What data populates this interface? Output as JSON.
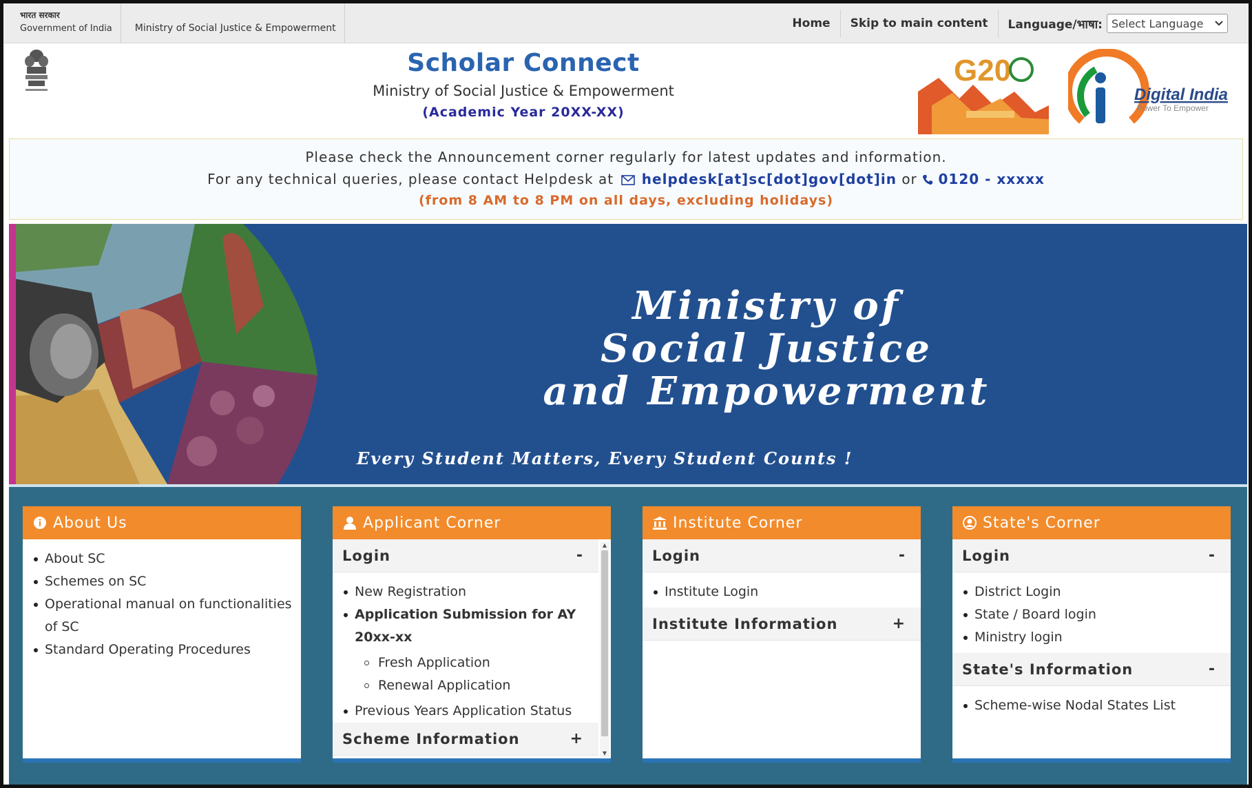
{
  "govbar": {
    "hindi_label": "भारत सरकार",
    "gov_label": "Government of India",
    "ministry_label": "Ministry of Social Justice & Empowerment",
    "links": [
      "Home",
      "Skip to main content"
    ],
    "language_label": "Language/भाषा:",
    "language_select": "Select Language"
  },
  "header": {
    "title": "Scholar Connect",
    "subtitle": "Ministry of Social Justice & Empowerment",
    "academic_year": "(Academic Year 20XX-XX)",
    "g20_text": "G20",
    "digital_india": "Digital India",
    "digital_india_tag": "Power To Empower"
  },
  "announcement": {
    "line1": "Please check the Announcement corner regularly for latest updates and information.",
    "line2_prefix": "For any technical queries, please contact Helpdesk at",
    "email": "helpdesk[at]sc[dot]gov[dot]in",
    "or": "or",
    "phone": "0120 - xxxxx",
    "line3": "(from 8 AM to 8 PM on all days, excluding holidays)"
  },
  "banner": {
    "title_line1": "Ministry of",
    "title_line2": "Social Justice",
    "title_line3": "and Empowerment",
    "tagline": "Every Student Matters, Every Student Counts !"
  },
  "cards": {
    "about": {
      "title": "About Us",
      "items": [
        "About SC",
        "Schemes on SC",
        "Operational manual on functionalities of SC",
        "Standard Operating Procedures"
      ]
    },
    "applicant": {
      "title": "Applicant Corner",
      "login_head": "Login",
      "login_toggle": "-",
      "new_registration": "New Registration",
      "application_submission": "Application Submission for AY 20xx-xx",
      "fresh": "Fresh Application",
      "renewal": "Renewal Application",
      "previous": "Previous Years Application Status",
      "scheme_head": "Scheme Information",
      "scheme_toggle": "+"
    },
    "institute": {
      "title": "Institute Corner",
      "login_head": "Login",
      "login_toggle": "-",
      "institute_login": "Institute Login",
      "info_head": "Institute Information",
      "info_toggle": "+"
    },
    "state": {
      "title": "State's Corner",
      "login_head": "Login",
      "login_toggle": "-",
      "items": [
        "District Login",
        "State / Board login",
        "Ministry login"
      ],
      "info_head": "State's Information",
      "info_toggle": "-",
      "info_items": [
        "Scheme-wise Nodal States List"
      ]
    }
  },
  "colors": {
    "accent_orange": "#f28b2b",
    "banner_blue": "#22508f",
    "title_blue": "#2a64b0",
    "lower_teal": "#2f6b86"
  }
}
